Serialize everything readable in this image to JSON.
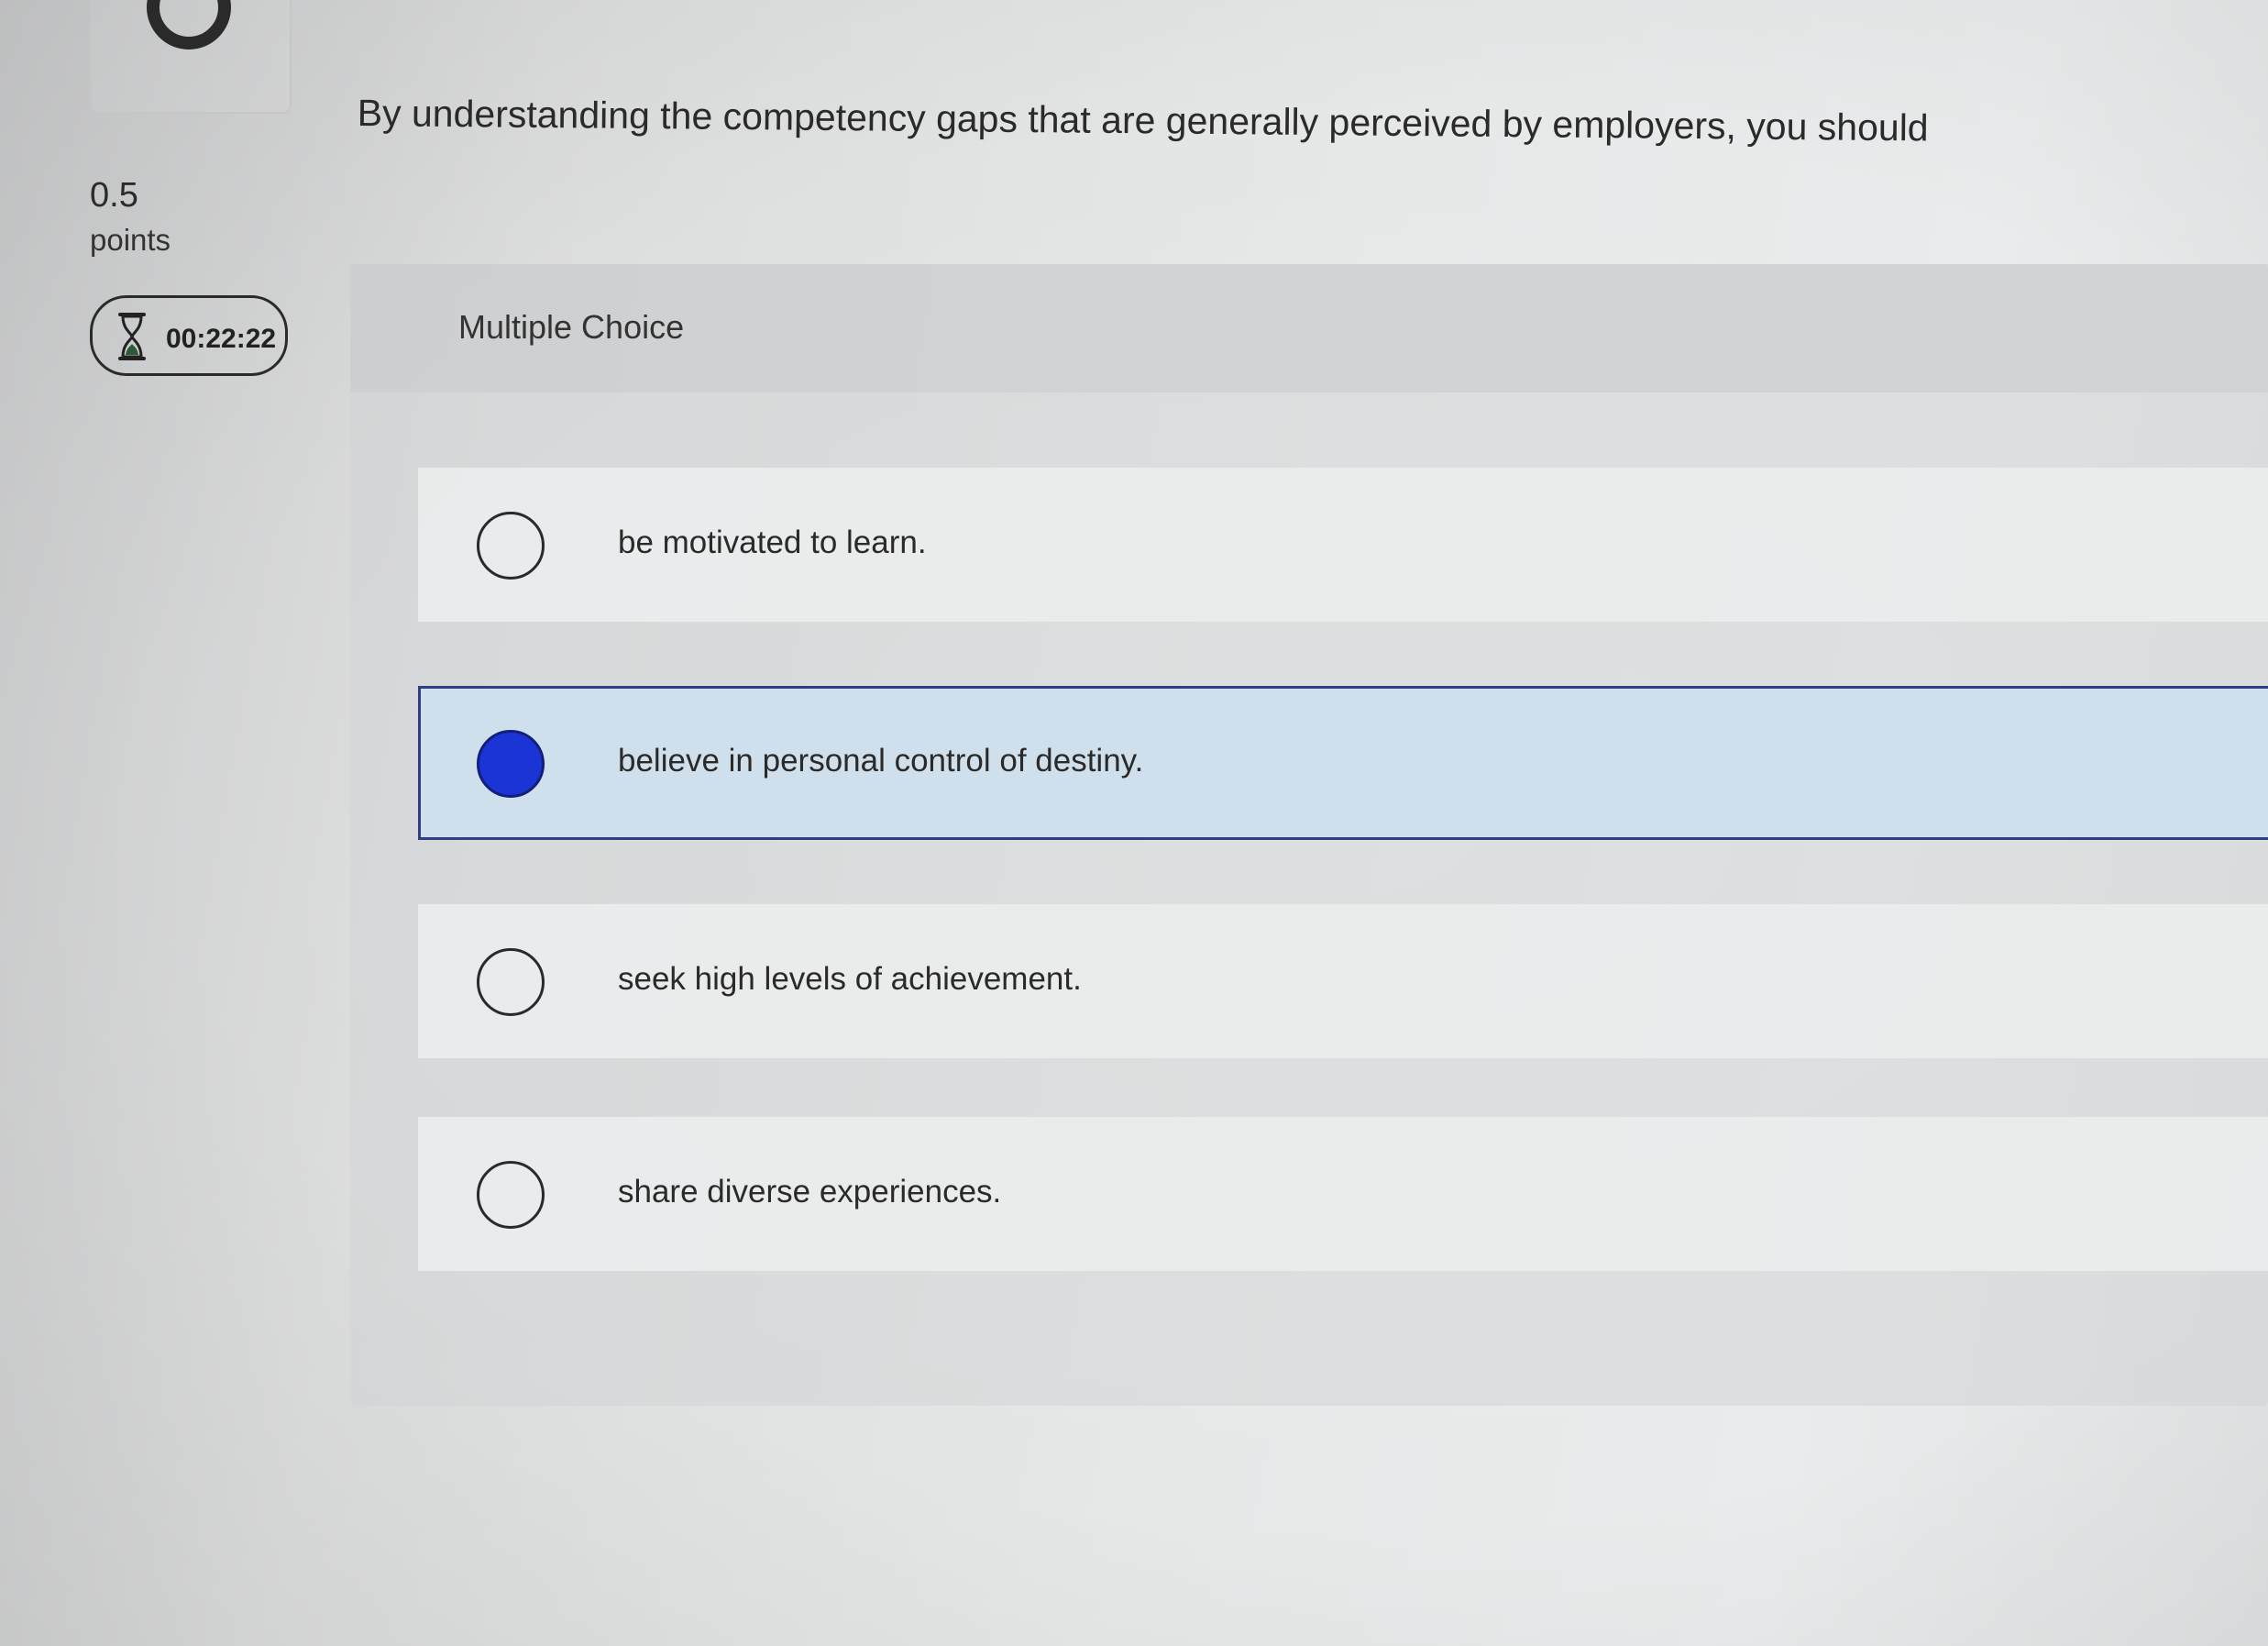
{
  "sidebar": {
    "points_value": "0.5",
    "points_label": "points",
    "timer": "00:22:22",
    "progress_icon": "progress-ring-icon",
    "timer_icon": "hourglass-icon"
  },
  "question": {
    "text": "By understanding the competency gaps that are generally perceived by employers, you should"
  },
  "answer_panel": {
    "type_label": "Multiple Choice",
    "choices": [
      {
        "label": "be motivated to learn.",
        "selected": false
      },
      {
        "label": "believe in personal control of destiny.",
        "selected": true
      },
      {
        "label": "seek high levels of achievement.",
        "selected": false
      },
      {
        "label": "share diverse experiences.",
        "selected": false
      }
    ]
  },
  "colors": {
    "selected_fill": "#1a34d6",
    "selected_background": "#cfe0ec",
    "selected_border": "#2f3f86"
  }
}
